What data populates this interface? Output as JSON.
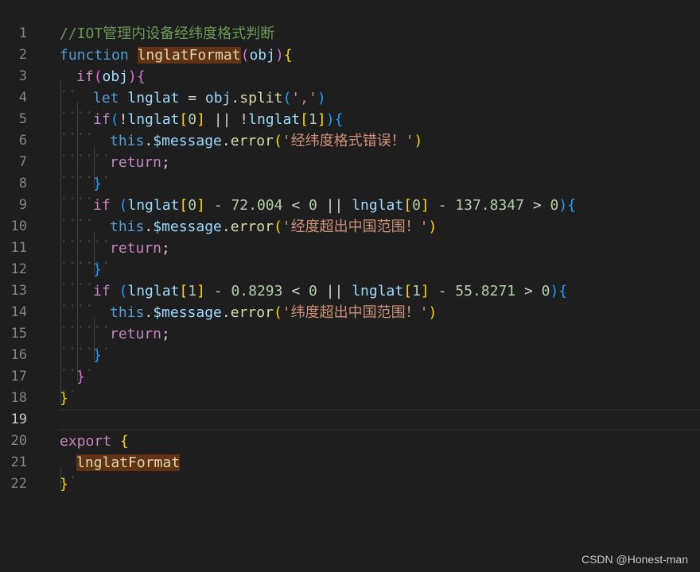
{
  "editor": {
    "lines": [
      {
        "num": "1",
        "tokens": [
          [
            "comment",
            "//IOT管理内设备经纬度格式判断"
          ]
        ]
      },
      {
        "num": "2",
        "tokens": [
          [
            "kw",
            "function"
          ],
          [
            "op",
            " "
          ],
          [
            "fn hl",
            "lnglatFormat"
          ],
          [
            "p2",
            "("
          ],
          [
            "var",
            "obj"
          ],
          [
            "p2",
            ")"
          ],
          [
            "p1",
            "{"
          ]
        ]
      },
      {
        "num": "3",
        "indent": 1,
        "tokens": [
          [
            "ctrl",
            "if"
          ],
          [
            "p2",
            "("
          ],
          [
            "var",
            "obj"
          ],
          [
            "p2",
            ")"
          ],
          [
            "p2",
            "{"
          ]
        ]
      },
      {
        "num": "4",
        "indent": 2,
        "tokens": [
          [
            "kw",
            "let"
          ],
          [
            "op",
            " "
          ],
          [
            "var",
            "lnglat"
          ],
          [
            "op",
            " = "
          ],
          [
            "var",
            "obj"
          ],
          [
            "op",
            "."
          ],
          [
            "fn",
            "split"
          ],
          [
            "p3",
            "("
          ],
          [
            "str",
            "','"
          ],
          [
            "p3",
            ")"
          ]
        ]
      },
      {
        "num": "5",
        "indent": 2,
        "tokens": [
          [
            "ctrl",
            "if"
          ],
          [
            "p3",
            "("
          ],
          [
            "op",
            "!"
          ],
          [
            "var",
            "lnglat"
          ],
          [
            "p1",
            "["
          ],
          [
            "num",
            "0"
          ],
          [
            "p1",
            "]"
          ],
          [
            "op",
            " || !"
          ],
          [
            "var",
            "lnglat"
          ],
          [
            "p1",
            "["
          ],
          [
            "num",
            "1"
          ],
          [
            "p1",
            "]"
          ],
          [
            "p3",
            ")"
          ],
          [
            "p3",
            "{"
          ]
        ]
      },
      {
        "num": "6",
        "indent": 3,
        "tokens": [
          [
            "kw",
            "this"
          ],
          [
            "op",
            "."
          ],
          [
            "var",
            "$message"
          ],
          [
            "op",
            "."
          ],
          [
            "fn",
            "error"
          ],
          [
            "p1",
            "("
          ],
          [
            "str",
            "'经纬度格式错误！'"
          ],
          [
            "p1",
            ")"
          ]
        ]
      },
      {
        "num": "7",
        "indent": 3,
        "tokens": [
          [
            "ctrl",
            "return"
          ],
          [
            "op",
            ";"
          ]
        ]
      },
      {
        "num": "8",
        "indent": 2,
        "tokens": [
          [
            "p3",
            "}"
          ]
        ]
      },
      {
        "num": "9",
        "indent": 2,
        "tokens": [
          [
            "ctrl",
            "if"
          ],
          [
            "op",
            " "
          ],
          [
            "p3",
            "("
          ],
          [
            "var",
            "lnglat"
          ],
          [
            "p1",
            "["
          ],
          [
            "num",
            "0"
          ],
          [
            "p1",
            "]"
          ],
          [
            "op",
            " - "
          ],
          [
            "num",
            "72.004"
          ],
          [
            "op",
            " < "
          ],
          [
            "num",
            "0"
          ],
          [
            "op",
            " || "
          ],
          [
            "var",
            "lnglat"
          ],
          [
            "p1",
            "["
          ],
          [
            "num",
            "0"
          ],
          [
            "p1",
            "]"
          ],
          [
            "op",
            " - "
          ],
          [
            "num",
            "137.8347"
          ],
          [
            "op",
            " > "
          ],
          [
            "num",
            "0"
          ],
          [
            "p3",
            ")"
          ],
          [
            "p3",
            "{"
          ]
        ]
      },
      {
        "num": "10",
        "indent": 3,
        "tokens": [
          [
            "kw",
            "this"
          ],
          [
            "op",
            "."
          ],
          [
            "var",
            "$message"
          ],
          [
            "op",
            "."
          ],
          [
            "fn",
            "error"
          ],
          [
            "p1",
            "("
          ],
          [
            "str",
            "'经度超出中国范围！'"
          ],
          [
            "p1",
            ")"
          ]
        ]
      },
      {
        "num": "11",
        "indent": 3,
        "tokens": [
          [
            "ctrl",
            "return"
          ],
          [
            "op",
            ";"
          ]
        ]
      },
      {
        "num": "12",
        "indent": 2,
        "tokens": [
          [
            "p3",
            "}"
          ]
        ]
      },
      {
        "num": "13",
        "indent": 2,
        "tokens": [
          [
            "ctrl",
            "if"
          ],
          [
            "op",
            " "
          ],
          [
            "p3",
            "("
          ],
          [
            "var",
            "lnglat"
          ],
          [
            "p1",
            "["
          ],
          [
            "num",
            "1"
          ],
          [
            "p1",
            "]"
          ],
          [
            "op",
            " - "
          ],
          [
            "num",
            "0.8293"
          ],
          [
            "op",
            " < "
          ],
          [
            "num",
            "0"
          ],
          [
            "op",
            " || "
          ],
          [
            "var",
            "lnglat"
          ],
          [
            "p1",
            "["
          ],
          [
            "num",
            "1"
          ],
          [
            "p1",
            "]"
          ],
          [
            "op",
            " - "
          ],
          [
            "num",
            "55.8271"
          ],
          [
            "op",
            " > "
          ],
          [
            "num",
            "0"
          ],
          [
            "p3",
            ")"
          ],
          [
            "p3",
            "{"
          ]
        ]
      },
      {
        "num": "14",
        "indent": 3,
        "tokens": [
          [
            "kw",
            "this"
          ],
          [
            "op",
            "."
          ],
          [
            "var",
            "$message"
          ],
          [
            "op",
            "."
          ],
          [
            "fn",
            "error"
          ],
          [
            "p1",
            "("
          ],
          [
            "str",
            "'纬度超出中国范围！'"
          ],
          [
            "p1",
            ")"
          ]
        ]
      },
      {
        "num": "15",
        "indent": 3,
        "tokens": [
          [
            "ctrl",
            "return"
          ],
          [
            "op",
            ";"
          ]
        ]
      },
      {
        "num": "16",
        "indent": 2,
        "tokens": [
          [
            "p3",
            "}"
          ]
        ]
      },
      {
        "num": "17",
        "indent": 1,
        "tokens": [
          [
            "p2",
            "}"
          ]
        ]
      },
      {
        "num": "18",
        "tokens": [
          [
            "p1",
            "}"
          ]
        ]
      },
      {
        "num": "19",
        "current": true,
        "tokens": []
      },
      {
        "num": "20",
        "tokens": [
          [
            "ctrl",
            "export"
          ],
          [
            "op",
            " "
          ],
          [
            "p1",
            "{"
          ]
        ]
      },
      {
        "num": "21",
        "indent": 1,
        "tokens": [
          [
            "fn hl",
            "lnglatFormat"
          ]
        ]
      },
      {
        "num": "22",
        "tokens": [
          [
            "p1",
            "}"
          ]
        ]
      }
    ]
  },
  "watermark": "CSDN @Honest-man",
  "colors": {
    "background": "#1e1e1e",
    "keyword": "#569cd6",
    "control": "#c586c0",
    "function": "#dcdcaa",
    "variable": "#9cdcfe",
    "string": "#ce9178",
    "number": "#b5cea8",
    "comment": "#6a9955",
    "bracket1": "#ffd700",
    "bracket2": "#da70d6",
    "bracket3": "#179fff",
    "highlight": "#613214"
  }
}
